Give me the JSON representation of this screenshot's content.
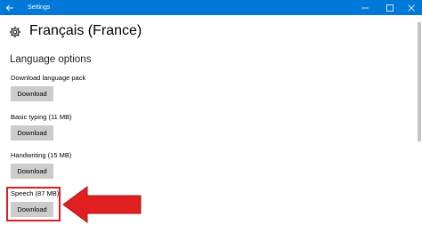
{
  "window": {
    "app_title": "Settings",
    "titlebar_color": "#0078d7",
    "controls": [
      "minimize-icon",
      "maximize-icon",
      "close-icon"
    ]
  },
  "page": {
    "title": "Français (France)",
    "section_title": "Language options"
  },
  "options": [
    {
      "label": "Download language pack",
      "button": "Download"
    },
    {
      "label": "Basic typing (11 MB)",
      "button": "Download"
    },
    {
      "label": "Handwriting (15 MB)",
      "button": "Download"
    },
    {
      "label": "Speech (87 MB)",
      "button": "Download"
    }
  ],
  "annotation": {
    "color": "#e02020",
    "highlighted_option": "Speech (87 MB)"
  }
}
